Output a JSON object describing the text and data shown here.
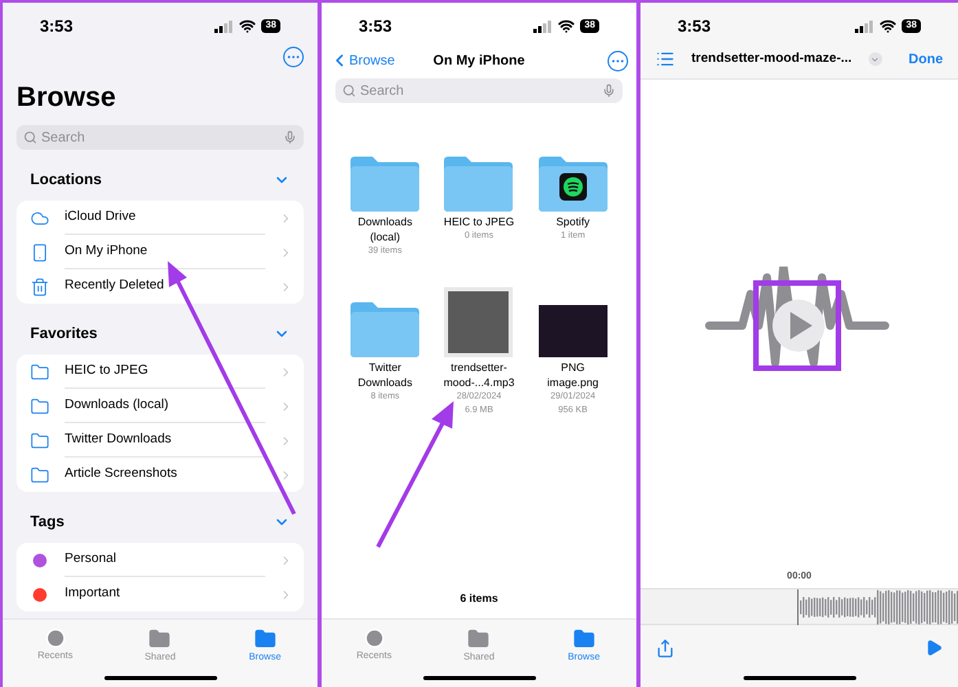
{
  "browse_screen": {
    "status": {
      "time": "3:53",
      "battery": "38"
    },
    "title": "Browse",
    "search": {
      "placeholder": "Search"
    },
    "sections": [
      {
        "title": "Locations",
        "expanded": true,
        "items": [
          {
            "label": "iCloud Drive",
            "kind": "cloud"
          },
          {
            "label": "On My iPhone",
            "kind": "phone"
          },
          {
            "label": "Recently Deleted",
            "kind": "trash"
          }
        ]
      },
      {
        "title": "Favorites",
        "expanded": true,
        "items": [
          {
            "label": "HEIC to JPEG",
            "kind": "folder"
          },
          {
            "label": "Downloads (local)",
            "kind": "folder"
          },
          {
            "label": "Twitter Downloads",
            "kind": "folder"
          },
          {
            "label": "Article Screenshots",
            "kind": "folder"
          }
        ]
      },
      {
        "title": "Tags",
        "expanded": true,
        "items": [
          {
            "label": "Personal",
            "kind": "tag",
            "color": "#af52de"
          },
          {
            "label": "Important",
            "kind": "tag",
            "color": "#ff3b30"
          }
        ]
      }
    ],
    "tab_bar": [
      {
        "label": "Recents",
        "kind": "recents",
        "selected": false
      },
      {
        "label": "Shared",
        "kind": "shared",
        "selected": false
      },
      {
        "label": "Browse",
        "kind": "browse",
        "selected": true
      }
    ]
  },
  "folder_screen": {
    "status": {
      "time": "3:53",
      "battery": "38"
    },
    "back": "Browse",
    "title": "On My iPhone",
    "search": {
      "placeholder": "Search"
    },
    "files": [
      {
        "name": "Downloads (local)",
        "kind": "folder",
        "details": [
          "39 items"
        ]
      },
      {
        "name": "HEIC to JPEG",
        "kind": "folder",
        "details": [
          "0 items"
        ]
      },
      {
        "name": "Spotify",
        "kind": "app-folder",
        "details": [
          "1 item"
        ]
      },
      {
        "name": "Twitter Downloads",
        "kind": "folder",
        "details": [
          "8 items"
        ]
      },
      {
        "name": "trendsetter-mood-...4.mp3",
        "kind": "audio",
        "details": [
          "28/02/2024",
          "6.9 MB"
        ]
      },
      {
        "name": "PNG image.png",
        "kind": "image",
        "details": [
          "29/01/2024",
          "956 KB"
        ]
      }
    ],
    "count": "6 items",
    "tab_bar": [
      {
        "label": "Recents",
        "kind": "recents",
        "selected": false
      },
      {
        "label": "Shared",
        "kind": "shared",
        "selected": false
      },
      {
        "label": "Browse",
        "kind": "browse",
        "selected": true
      }
    ]
  },
  "player_screen": {
    "status": {
      "time": "3:53",
      "battery": "38"
    },
    "title": "trendsetter-mood-maze-...",
    "done": "Done",
    "time": "00:00"
  }
}
